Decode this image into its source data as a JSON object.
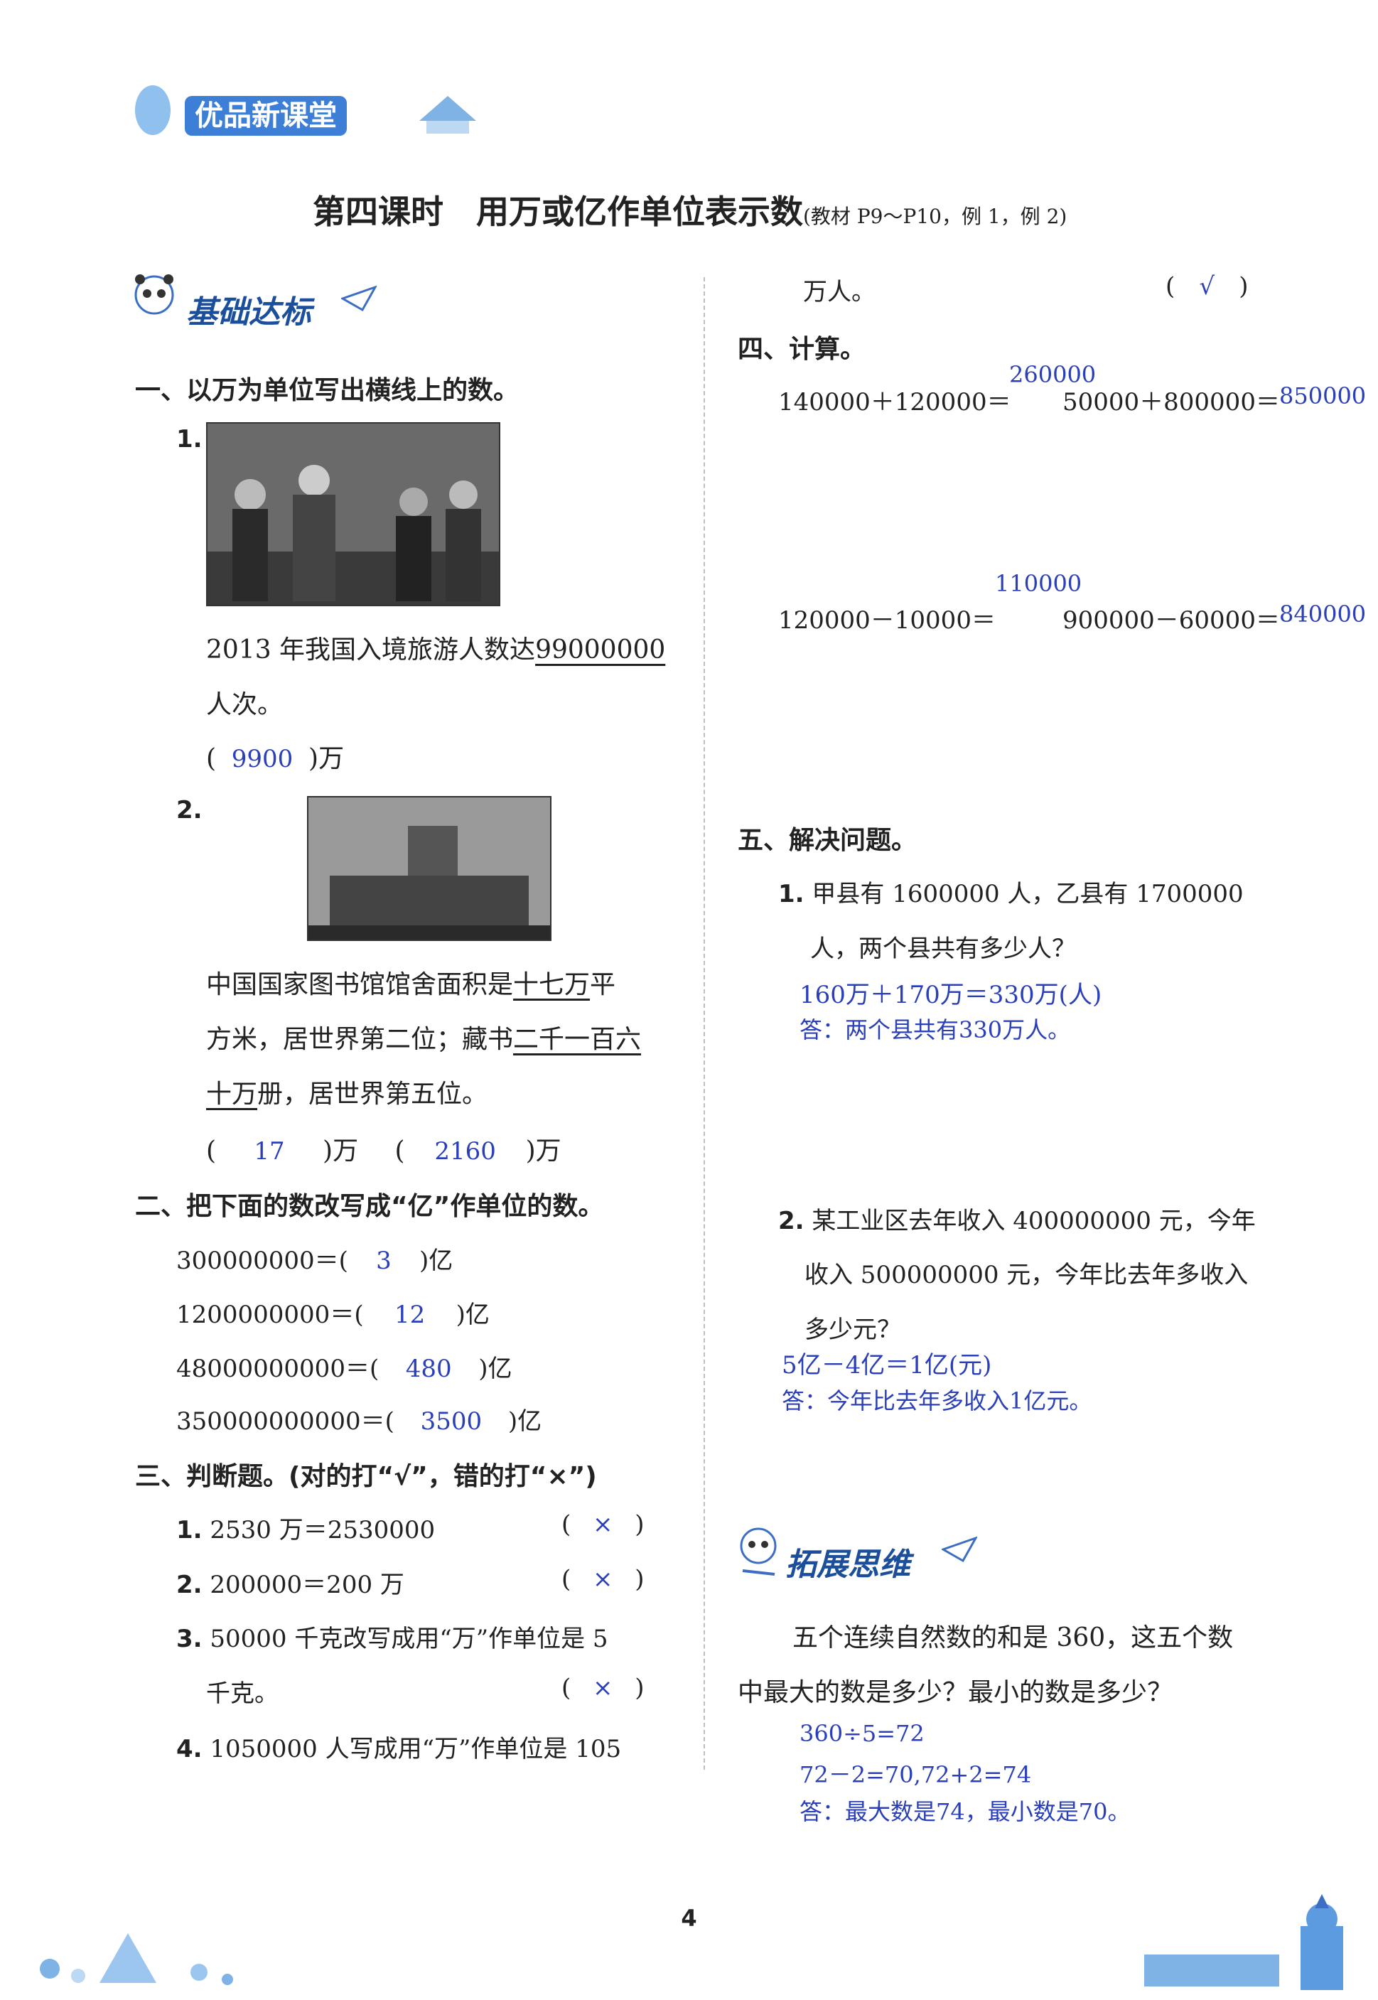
{
  "header": {
    "brand": "优品新课堂"
  },
  "lesson": {
    "title": "第四课时　用万或亿作单位表示数",
    "ref": "(教材 P9～P10，例 1，例 2)"
  },
  "sections": {
    "basic": "基础达标",
    "extend": "拓展思维"
  },
  "q1": {
    "heading": "一、以万为单位写出横线上的数。",
    "items": [
      {
        "num": "1.",
        "text_a": "2013 年我国入境旅游人数达",
        "under": "99000000",
        "text_b": "人次。",
        "answer": "9900",
        "unit": ")万"
      },
      {
        "num": "2.",
        "line1a": "中国国家图书馆馆舍面积是",
        "line1u": "十七万",
        "line1b": "平",
        "line2a": "方米，居世界第二位；藏书",
        "line2u": "二千一百六",
        "line3u": "十万",
        "line3b": "册，居世界第五位。",
        "ans1": "17",
        "ans2": "2160",
        "unit": ")万"
      }
    ]
  },
  "q2": {
    "heading": "二、把下面的数改写成“亿”作单位的数。",
    "rows": [
      {
        "expr": "300000000＝(",
        "ans": "3",
        "unit": ")亿"
      },
      {
        "expr": "1200000000＝(",
        "ans": "12",
        "unit": ")亿"
      },
      {
        "expr": "48000000000＝(",
        "ans": "480",
        "unit": ")亿"
      },
      {
        "expr": "350000000000＝(",
        "ans": "3500",
        "unit": ")亿"
      }
    ]
  },
  "q3": {
    "heading": "三、判断题。(对的打“√”，错的打“×”)",
    "items": [
      {
        "num": "1.",
        "text": "2530 万＝2530000",
        "ans": "×"
      },
      {
        "num": "2.",
        "text": "200000＝200 万",
        "ans": "×"
      },
      {
        "num": "3.",
        "text": "50000 千克改写成用“万”作单位是 5",
        "cont": "千克。",
        "ans": "×"
      },
      {
        "num": "4.",
        "text": "1050000 人写成用“万”作单位是 105",
        "cont": "万人。",
        "ans": "√"
      }
    ]
  },
  "q4": {
    "heading": "四、计算。",
    "items": [
      {
        "expr": "140000＋120000＝",
        "ans": "260000"
      },
      {
        "expr": "50000＋800000＝",
        "ans": "850000"
      },
      {
        "expr": "120000－10000＝",
        "ans": "110000"
      },
      {
        "expr": "900000－60000＝",
        "ans": "840000"
      }
    ]
  },
  "q5": {
    "heading": "五、解决问题。",
    "p1": {
      "num": "1.",
      "line1": "甲县有 1600000 人，乙县有 1700000",
      "line2": "人，两个县共有多少人？",
      "work": "160万＋170万＝330万(人)",
      "answer": "答：两个县共有330万人。"
    },
    "p2": {
      "num": "2.",
      "line1": "某工业区去年收入 400000000 元，今年",
      "line2": "收入 500000000 元，今年比去年多收入",
      "line3": "多少元？",
      "work": "5亿－4亿＝1亿(元)",
      "answer": "答：今年比去年多收入1亿元。"
    }
  },
  "extend": {
    "line1": "五个连续自然数的和是 360，这五个数",
    "line2": "中最大的数是多少？最小的数是多少？",
    "work1": "360÷5=72",
    "work2": "72－2=70,72+2=74",
    "answer": "答：最大数是74，最小数是70。"
  },
  "footer": {
    "page": "4"
  }
}
